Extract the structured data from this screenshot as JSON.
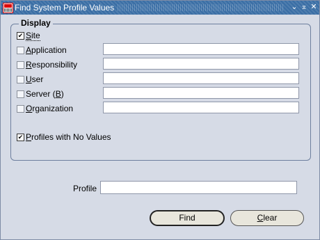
{
  "window": {
    "title": "Find System Profile Values",
    "controls": {
      "minimize": "⌄",
      "maximize": "⌅",
      "close": "✕"
    }
  },
  "display": {
    "frame_title": "Display",
    "options": [
      {
        "pre": "",
        "u": "S",
        "post": "ite",
        "checked": true,
        "has_field": false,
        "value": ""
      },
      {
        "pre": "",
        "u": "A",
        "post": "pplication",
        "checked": false,
        "has_field": true,
        "value": ""
      },
      {
        "pre": "",
        "u": "R",
        "post": "esponsibility",
        "checked": false,
        "has_field": true,
        "value": ""
      },
      {
        "pre": "",
        "u": "U",
        "post": "ser",
        "checked": false,
        "has_field": true,
        "value": ""
      },
      {
        "pre": "Server (",
        "u": "B",
        "post": ")",
        "checked": false,
        "has_field": true,
        "value": ""
      },
      {
        "pre": "",
        "u": "O",
        "post": "rganization",
        "checked": false,
        "has_field": true,
        "value": ""
      }
    ],
    "no_values": {
      "pre": "",
      "u": "P",
      "post": "rofiles with No Values",
      "checked": true
    }
  },
  "profile": {
    "label": "Profile",
    "value": ""
  },
  "buttons": {
    "find": {
      "pre": "",
      "u": "",
      "post": "Find"
    },
    "clear": {
      "pre": "",
      "u": "C",
      "post": "lear"
    }
  }
}
